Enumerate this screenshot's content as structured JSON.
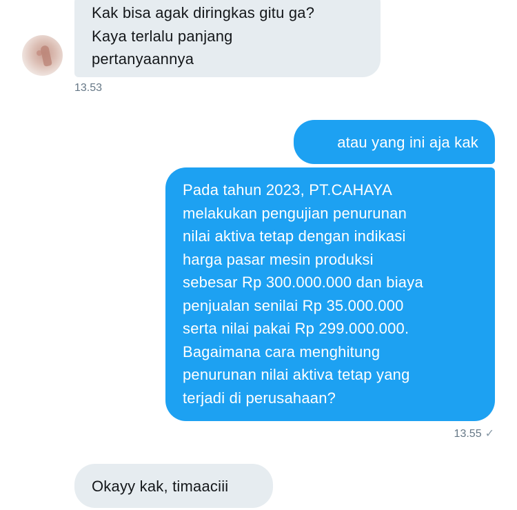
{
  "messages": [
    {
      "id": "m1",
      "direction": "incoming",
      "text": "Kak bisa agak diringkas gitu ga?\nKaya terlalu panjang\npertanyaannya",
      "time": "13.53"
    },
    {
      "id": "m2",
      "direction": "outgoing",
      "text": "atau yang ini aja kak"
    },
    {
      "id": "m3",
      "direction": "outgoing",
      "text": "Pada tahun 2023, PT.CAHAYA\nmelakukan pengujian penurunan\nnilai aktiva tetap dengan indikasi\nharga pasar mesin produksi\nsebesar Rp 300.000.000 dan biaya\npenjualan senilai Rp 35.000.000\nserta nilai pakai Rp 299.000.000.\nBagaimana cara menghitung\npenurunan nilai aktiva tetap yang\nterjadi di perusahaan?",
      "time": "13.55",
      "status_icon": "check-icon"
    },
    {
      "id": "m4",
      "direction": "incoming",
      "text": "Okayy kak, timaaciii"
    }
  ],
  "colors": {
    "incoming_bg": "#e6ecf0",
    "outgoing_bg": "#1da1f2",
    "timestamp": "#657786"
  }
}
